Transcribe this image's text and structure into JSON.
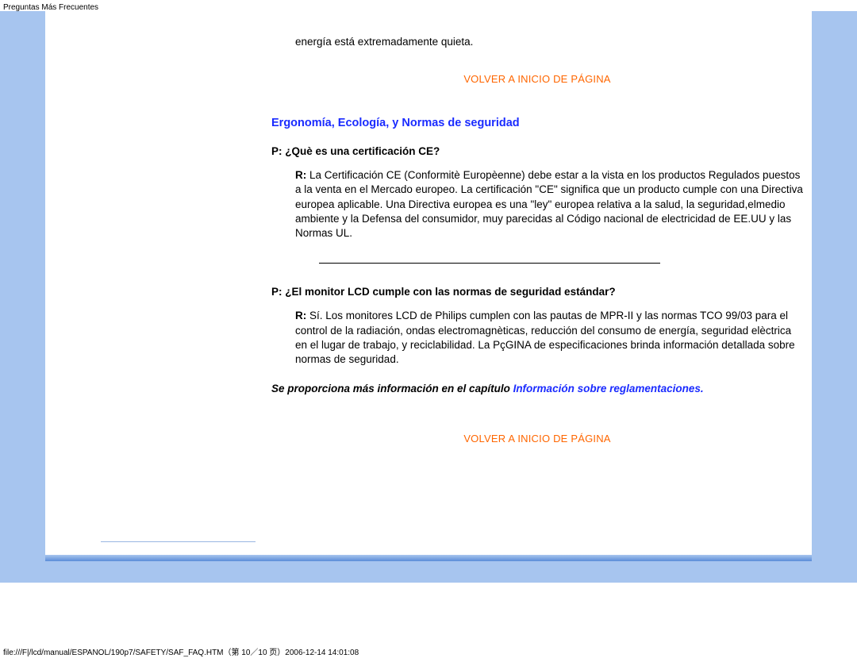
{
  "header": {
    "title": "Preguntas Más Frecuentes"
  },
  "top_fragment": {
    "text": "energía está extremadamente quieta."
  },
  "links": {
    "back_to_top": "VOLVER A INICIO DE PÁGINA"
  },
  "section": {
    "title": "Ergonomía, Ecología, y Normas de seguridad"
  },
  "qa": [
    {
      "question": "P: ¿Què es una certificación CE?",
      "answer_label": "R:",
      "answer": " La Certificación CE (Conformitè Europèenne) debe estar a la vista en los productos Regulados puestos a la venta en el Mercado europeo. La certificación \"CE\" significa que un producto cumple con una Directiva europea aplicable. Una Directiva europea es una \"ley\" europea relativa a la salud, la seguridad,elmedio ambiente y la Defensa del consumidor, muy parecidas al Código nacional de electricidad de EE.UU y las Normas UL."
    },
    {
      "question": "P: ¿El monitor LCD cumple con las normas de seguridad estándar?",
      "answer_label": "R:",
      "answer": " Sí. Los monitores LCD de Philips cumplen con las pautas de MPR-II y las normas TCO 99/03 para el control de la radiación, ondas electromagnèticas, reducción del consumo de energía, seguridad elèctrica en el lugar de trabajo, y reciclabilidad. La PçGINA de especificaciones brinda información detallada sobre normas de seguridad."
    }
  ],
  "more_info": {
    "prefix": "Se proporciona más información en el capítulo ",
    "link": "Información sobre reglamentaciones."
  },
  "footer": {
    "path": "file:///F|/lcd/manual/ESPANOL/190p7/SAFETY/SAF_FAQ.HTM（第 10／10 页）2006-12-14 14:01:08"
  }
}
